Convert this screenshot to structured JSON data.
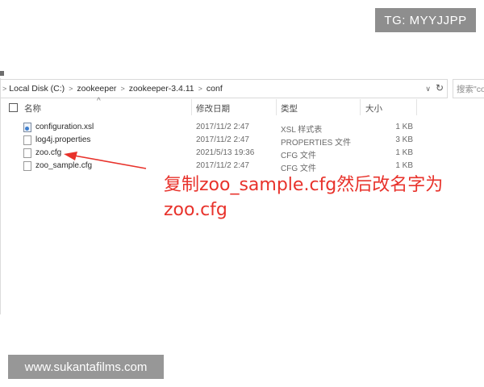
{
  "badge": {
    "text": "TG: MYYJJPP"
  },
  "address_bar": {
    "crumbs": [
      "Local Disk (C:)",
      "zookeeper",
      "zookeeper-3.4.11",
      "conf"
    ],
    "separator": ">",
    "dropdown_glyph": "∨",
    "refresh_glyph": "↻"
  },
  "search": {
    "placeholder": "搜索\"co"
  },
  "columns": {
    "name": "名称",
    "modified": "修改日期",
    "type": "类型",
    "size": "大小",
    "sort_indicator": "^"
  },
  "files": [
    {
      "name": "configuration.xsl",
      "modified": "2017/11/2 2:47",
      "type": "XSL 样式表",
      "size": "1 KB",
      "icon": "xsl-file-icon"
    },
    {
      "name": "log4j.properties",
      "modified": "2017/11/2 2:47",
      "type": "PROPERTIES 文件",
      "size": "3 KB",
      "icon": "file-icon"
    },
    {
      "name": "zoo.cfg",
      "modified": "2021/5/13 19:36",
      "type": "CFG 文件",
      "size": "1 KB",
      "icon": "file-icon"
    },
    {
      "name": "zoo_sample.cfg",
      "modified": "2017/11/2 2:47",
      "type": "CFG 文件",
      "size": "1 KB",
      "icon": "file-icon"
    }
  ],
  "annotation": {
    "line1": "复制zoo_sample.cfg然后改名字为",
    "line2": "zoo.cfg",
    "color": "#e8322b"
  },
  "watermark": {
    "text": "www.sukantafilms.com"
  }
}
